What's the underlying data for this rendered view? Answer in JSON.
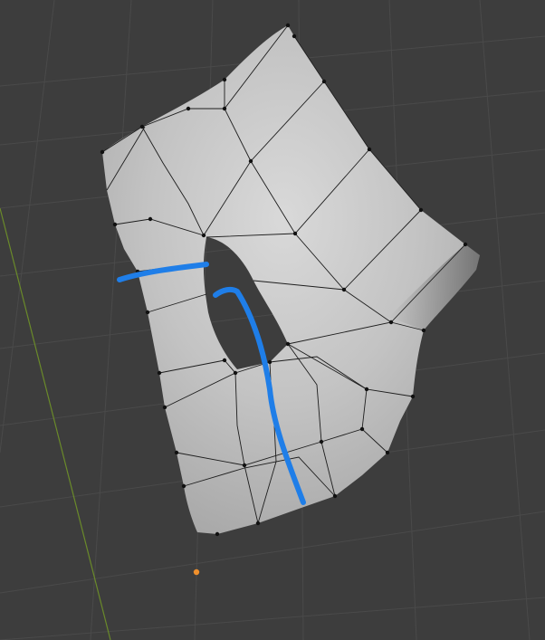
{
  "viewport": {
    "background": "#3d3d3d",
    "grid_color": "#4a4a4a",
    "y_axis_color": "#6a8a2a"
  },
  "mesh": {
    "face_color": "#c8c8c8",
    "edge_color": "#1d1d1d",
    "vertex_color": "#111111"
  },
  "annotations": {
    "stroke_color": "#1f7ee8",
    "strokes": [
      "horizontal-cut-stroke",
      "arrow-up-stroke"
    ]
  },
  "object_origin": {
    "color": "#f0902c"
  }
}
